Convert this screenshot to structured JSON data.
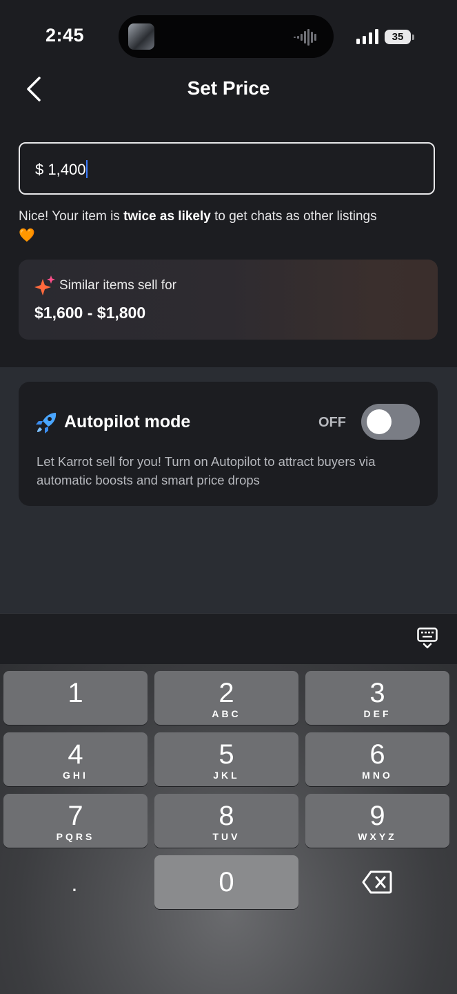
{
  "status": {
    "time": "2:45",
    "battery": "35"
  },
  "header": {
    "title": "Set Price"
  },
  "price": {
    "currency": "$",
    "value": "1,400"
  },
  "hint": {
    "pre": "Nice! Your item is ",
    "bold": "twice as likely",
    "post": " to get chats as other listings",
    "emoji": "🧡"
  },
  "similar": {
    "label": "Similar items sell for",
    "range": "$1,600 - $1,800"
  },
  "autopilot": {
    "title": "Autopilot mode",
    "state": "OFF",
    "description": "Let Karrot sell for you! Turn on Autopilot to attract buyers via automatic boosts and smart price drops"
  },
  "keyboard": {
    "keys": [
      {
        "digit": "1",
        "letters": ""
      },
      {
        "digit": "2",
        "letters": "ABC"
      },
      {
        "digit": "3",
        "letters": "DEF"
      },
      {
        "digit": "4",
        "letters": "GHI"
      },
      {
        "digit": "5",
        "letters": "JKL"
      },
      {
        "digit": "6",
        "letters": "MNO"
      },
      {
        "digit": "7",
        "letters": "PQRS"
      },
      {
        "digit": "8",
        "letters": "TUV"
      },
      {
        "digit": "9",
        "letters": "WXYZ"
      },
      {
        "digit": "0",
        "letters": ""
      }
    ],
    "decimal": "."
  }
}
